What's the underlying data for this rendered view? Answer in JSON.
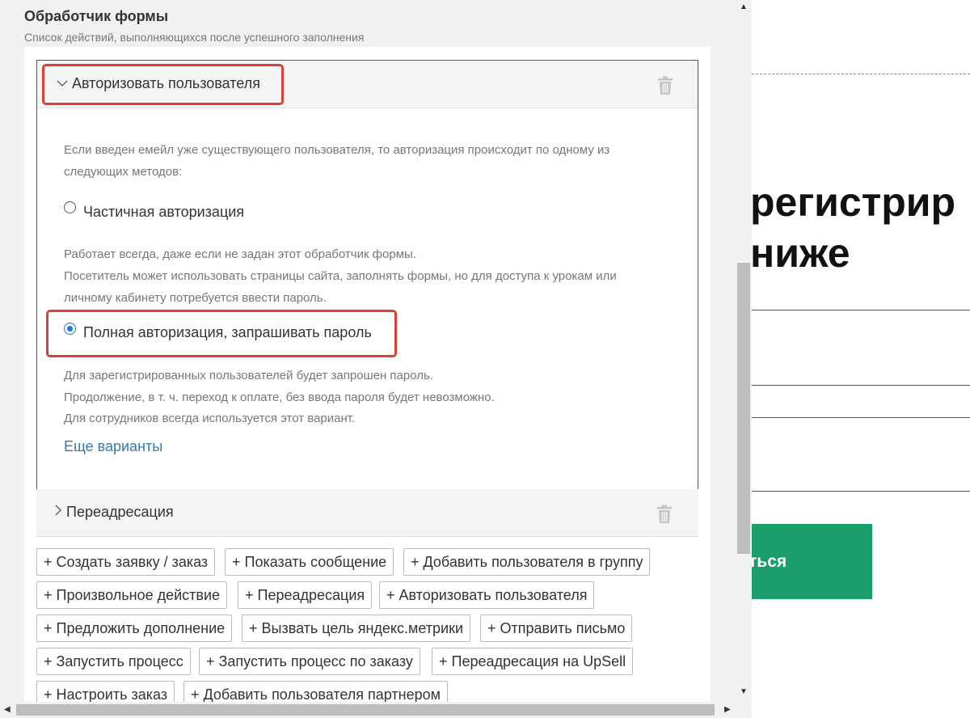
{
  "background": {
    "heading_line1": "регистрир",
    "heading_line2": "ниже",
    "green_button_label": "ться",
    "accent_color": "#1b9e6b"
  },
  "panel": {
    "title": "Обработчик формы",
    "subtitle": "Список действий, выполняющихся после успешного заполнения"
  },
  "auth_section": {
    "title": "Авторизовать пользователя",
    "intro_line1": "Если введен емейл уже существующего пользователя, то авторизация происходит по одному из",
    "intro_line2": "следующих методов:",
    "option_partial": {
      "label": "Частичная авторизация",
      "checked": false,
      "desc_line1": "Работает всегда, даже если не задан этот обработчик формы.",
      "desc_line2": "Посетитель может использовать страницы сайта, заполнять формы, но для доступа к урокам или",
      "desc_line3": "личному кабинету потребуется ввести пароль."
    },
    "option_full": {
      "label": "Полная авторизация, запрашивать пароль",
      "checked": true,
      "desc_line1": "Для зарегистрированных пользователей будет запрошен пароль.",
      "desc_line2": "Продолжение, в т. ч. переход к оплате, без ввода пароля будет невозможно.",
      "desc_line3": "Для сотрудников всегда используется этот вариант."
    },
    "more_link": "Еще варианты"
  },
  "redirect_section": {
    "title": "Переадресация"
  },
  "add_buttons": [
    "+ Создать заявку / заказ",
    "+ Показать сообщение",
    "+ Добавить пользователя в группу",
    "+ Произвольное действие",
    "+ Переадресация",
    "+ Авторизовать пользователя",
    "+ Предложить дополнение",
    "+ Вызвать цель яндекс.метрики",
    "+ Отправить письмо",
    "+ Запустить процесс",
    "+ Запустить процесс по заказу",
    "+ Переадресация на UpSell",
    "+ Настроить заказ",
    "+ Добавить пользователя партнером"
  ],
  "icons": {
    "delete": "trash-icon",
    "expanded": "chevron-down-icon",
    "collapsed": "chevron-right-icon"
  },
  "highlight_color": "#d9403a",
  "radio_color": "#1a73e8"
}
